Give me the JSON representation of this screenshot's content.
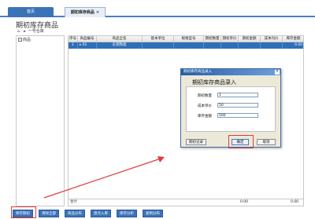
{
  "tabs": [
    {
      "label": "首页",
      "close": ""
    },
    {
      "label": "期初库存商品",
      "close": "✕"
    }
  ],
  "page_title": "期初库存商品",
  "breadcrumb": {
    "icon": "⌂",
    "separator": "▸",
    "label": "一号仓库"
  },
  "tree": {
    "toggle": "-",
    "label": "商品"
  },
  "grid": {
    "headers": [
      "序号",
      "商品编号",
      "商品全名",
      "基本单位",
      "规格型号",
      "期初数量",
      "期初单价",
      "期初金额",
      "成本均价",
      "库存金额"
    ],
    "rows": [
      [
        "1",
        "▸ 01",
        "东莞陶瓷",
        "",
        "",
        "",
        "",
        "",
        "",
        "0.00"
      ]
    ],
    "footer": {
      "label": "合计",
      "qty": "",
      "amount": "0.00",
      "total": "0.00"
    }
  },
  "dialog": {
    "title": "期初库存商品录入",
    "heading": "期初库存商品录入",
    "fields": [
      {
        "label": "期初数量",
        "value": "1"
      },
      {
        "label": "成本单价",
        "value": "50"
      },
      {
        "label": "库存金额",
        "value": "500"
      }
    ],
    "buttons": {
      "history": "期初记录",
      "ok": "确定",
      "cancel": "取消"
    },
    "close": "✕"
  },
  "bottom_buttons": [
    "保存期初",
    "清除全部",
    "商品分布",
    "盘点入库",
    "库存分析",
    "复制分布"
  ],
  "colors": {
    "accent": "#3b73b9",
    "selection": "#2f6fb8",
    "highlight": "#e03c3c"
  }
}
